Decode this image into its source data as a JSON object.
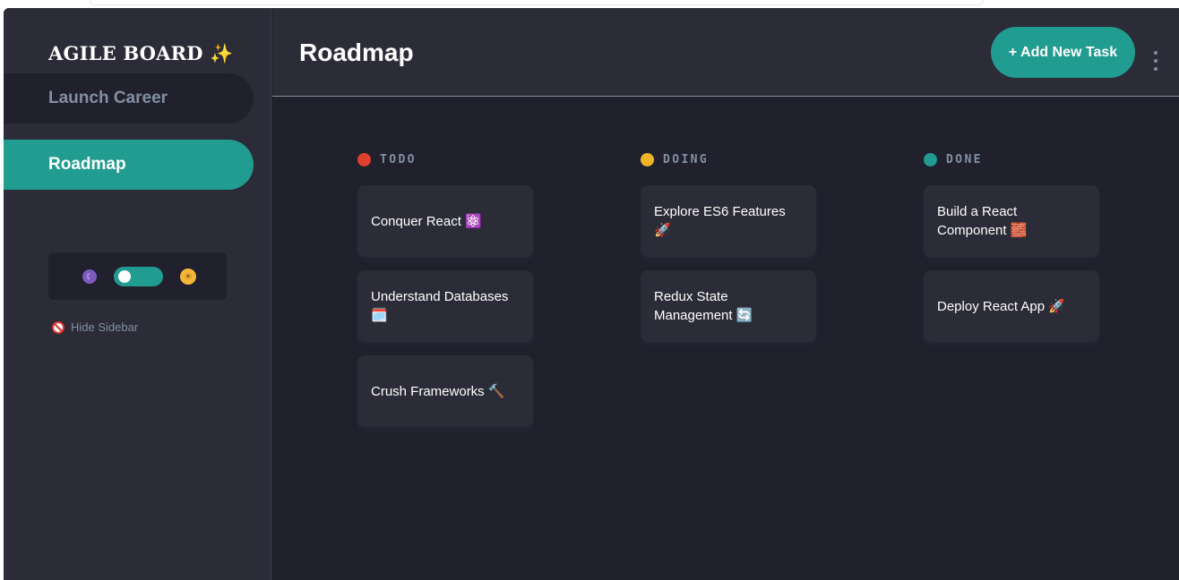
{
  "sidebar": {
    "brand": "AGILE BOARD ✨",
    "boards": [
      {
        "label": "Launch Career"
      },
      {
        "label": "Roadmap"
      }
    ],
    "theme": {
      "dark_icon": "moon-icon",
      "light_icon": "sun-icon",
      "mode": "dark"
    },
    "hide_label": "Hide Sidebar"
  },
  "header": {
    "title": "Roadmap",
    "add_button": "+ Add New Task"
  },
  "columns": [
    {
      "title": "TODO",
      "color": "#e0402e",
      "tasks": [
        "Conquer React ⚛️",
        "Understand Databases 🗓️",
        "Crush Frameworks 🔨"
      ]
    },
    {
      "title": "DOING",
      "color": "#f0b429",
      "tasks": [
        "Explore ES6 Features 🚀",
        "Redux State Management 🔄"
      ]
    },
    {
      "title": "DONE",
      "color": "#219c90",
      "tasks": [
        "Build a React Component 🧱",
        "Deploy React App 🚀"
      ]
    }
  ],
  "colors": {
    "accent": "#219c90",
    "sidebar": "#2b2c37",
    "board": "#21212d"
  }
}
